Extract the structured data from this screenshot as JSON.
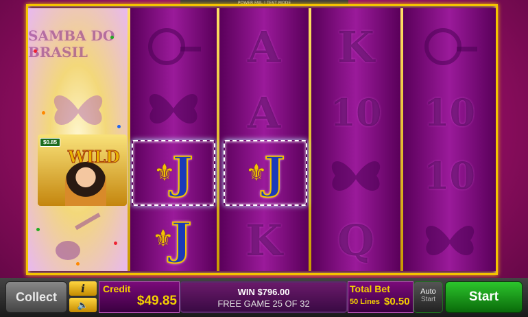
{
  "test_banner": "POWER FAIL | TEST MODE",
  "reels": {
    "reel1": {
      "top_symbol_text": "SAMBA DO BRASIL",
      "wild_text": "WILD",
      "mini_win": "$0.85"
    },
    "reel3": {
      "symbols": [
        "A",
        "A",
        "K"
      ]
    },
    "reel4": {
      "symbols": [
        "K",
        "10",
        "Q"
      ]
    },
    "reel5": {
      "symbols": [
        "10",
        "10"
      ]
    },
    "jack_symbol": "J"
  },
  "bottom": {
    "collect_label": "Collect",
    "info_label": "i",
    "credit_label": "Credit",
    "credit_value": "$49.85",
    "win_text": "WIN $796.00",
    "free_game_text": "FREE GAME 25 OF 32",
    "total_bet_label": "Total Bet",
    "lines_label": "50 Lines",
    "bet_value": "$0.50",
    "auto_label_top": "Auto",
    "auto_label_bottom": "Start",
    "start_label": "Start"
  },
  "colors": {
    "frame": "#f4c400",
    "reel": "#9a1a9a",
    "start": "#2cc52c",
    "text_accent": "#f4d000"
  }
}
